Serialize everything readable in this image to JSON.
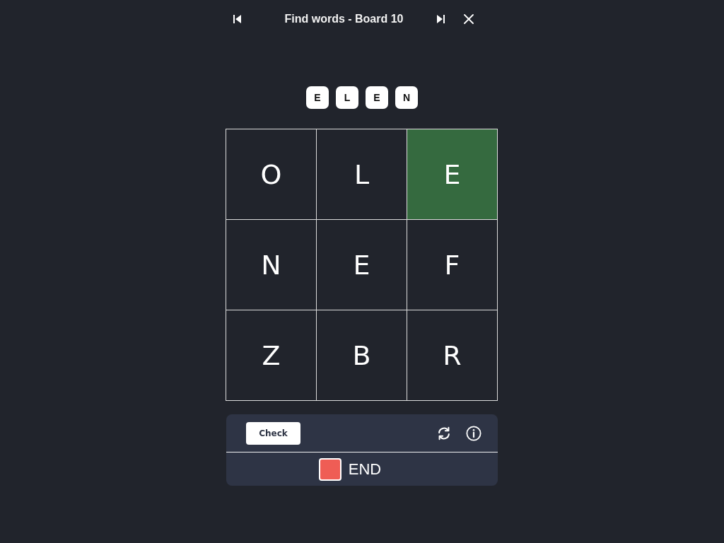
{
  "header": {
    "title": "Find words - Board 10"
  },
  "word_tiles": [
    "E",
    "L",
    "E",
    "N"
  ],
  "grid": {
    "cells": [
      {
        "letter": "O",
        "selected": false
      },
      {
        "letter": "L",
        "selected": false
      },
      {
        "letter": "E",
        "selected": true
      },
      {
        "letter": "N",
        "selected": false
      },
      {
        "letter": "E",
        "selected": false
      },
      {
        "letter": "F",
        "selected": false
      },
      {
        "letter": "Z",
        "selected": false
      },
      {
        "letter": "B",
        "selected": false
      },
      {
        "letter": "R",
        "selected": false
      }
    ]
  },
  "controls": {
    "check_button": "Check"
  },
  "status": {
    "label": "END",
    "color": "#ef5d55"
  }
}
